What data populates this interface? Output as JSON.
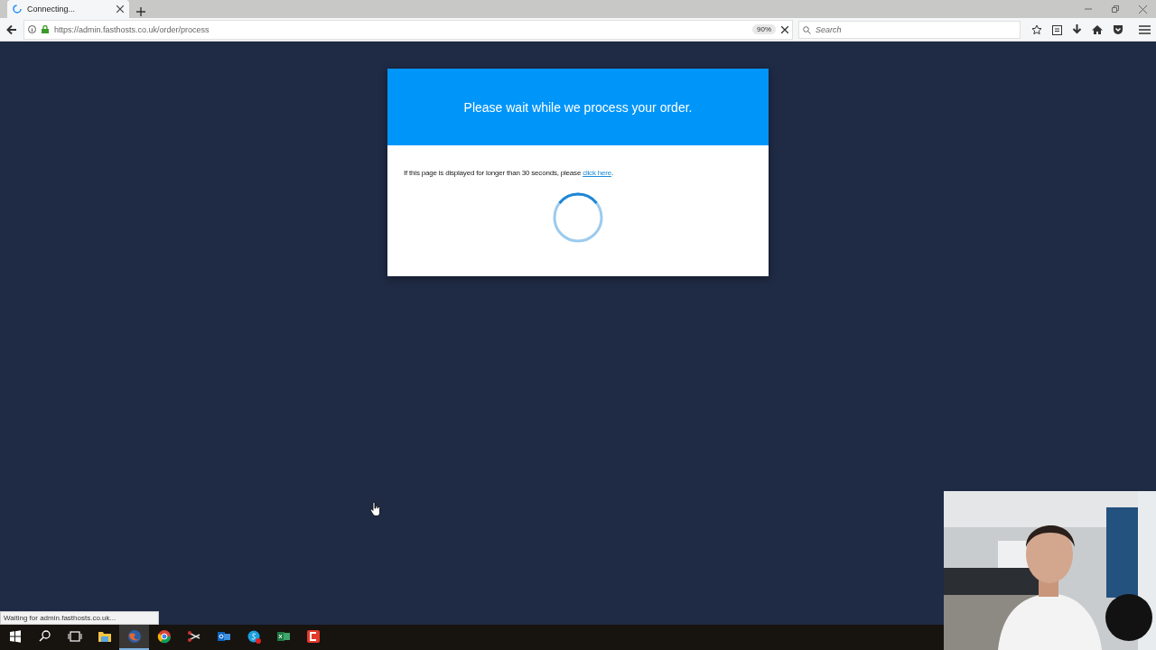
{
  "browser": {
    "tab": {
      "title": "Connecting...",
      "loading": true
    },
    "url": "https://admin.fasthosts.co.uk/order/process",
    "zoom": "90%",
    "search": {
      "placeholder": "Search"
    },
    "status": "Waiting for admin.fasthosts.co.uk..."
  },
  "card": {
    "heading": "Please wait while we process your order.",
    "notice": "If this page is displayed for longer than 30 seconds, please ",
    "link": "click here",
    "notice_end": "."
  },
  "taskbar": [
    {
      "kind": "start",
      "selected": false
    },
    {
      "kind": "search",
      "selected": false
    },
    {
      "kind": "taskview",
      "selected": false
    },
    {
      "kind": "folder",
      "selected": false
    },
    {
      "kind": "fox",
      "selected": true
    },
    {
      "kind": "ring",
      "selected": false
    },
    {
      "kind": "scissors",
      "selected": false
    },
    {
      "kind": "mail",
      "selected": false
    },
    {
      "kind": "chat",
      "selected": false
    },
    {
      "kind": "sheet",
      "selected": false
    },
    {
      "kind": "record",
      "selected": false
    }
  ]
}
